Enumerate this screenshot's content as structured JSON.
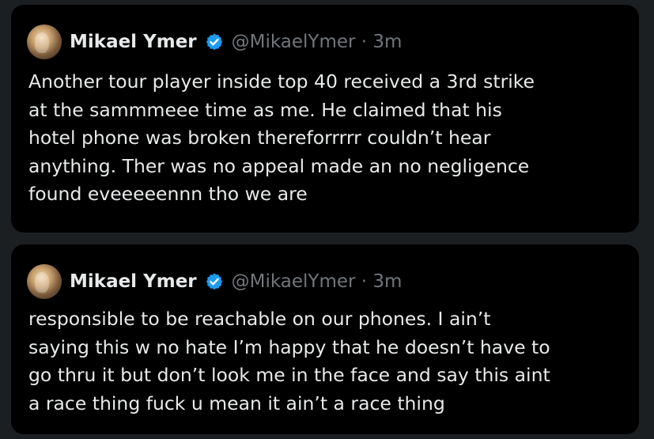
{
  "tweets": [
    {
      "author": "Mikael Ymer",
      "handle_time": "@MikaelYmer · 3m",
      "avatar_icon": "user-avatar",
      "verified_icon": "verified-badge-icon",
      "text": "Another tour player inside top 40 received a 3rd strike\nat the sammmeee time as me. He claimed that his\nhotel phone was broken thereforrrrr couldn’t hear\nanything. Ther was no appeal made an no negligence\nfound eveeeeennn tho we are"
    },
    {
      "author": "Mikael Ymer",
      "handle_time": "@MikaelYmer · 3m",
      "avatar_icon": "user-avatar",
      "verified_icon": "verified-badge-icon",
      "text": "responsible to be reachable on our phones. I ain’t\nsaying this w no hate I’m happy that he doesn’t have to\ngo thru it but don’t look me in the face and say this aint\na race thing fuck u mean it ain’t a race thing"
    }
  ],
  "colors": {
    "background": "#1c1f22",
    "card": "#000000",
    "text": "#e7e9ea",
    "muted": "#71767b",
    "verified": "#1d9bf0"
  }
}
